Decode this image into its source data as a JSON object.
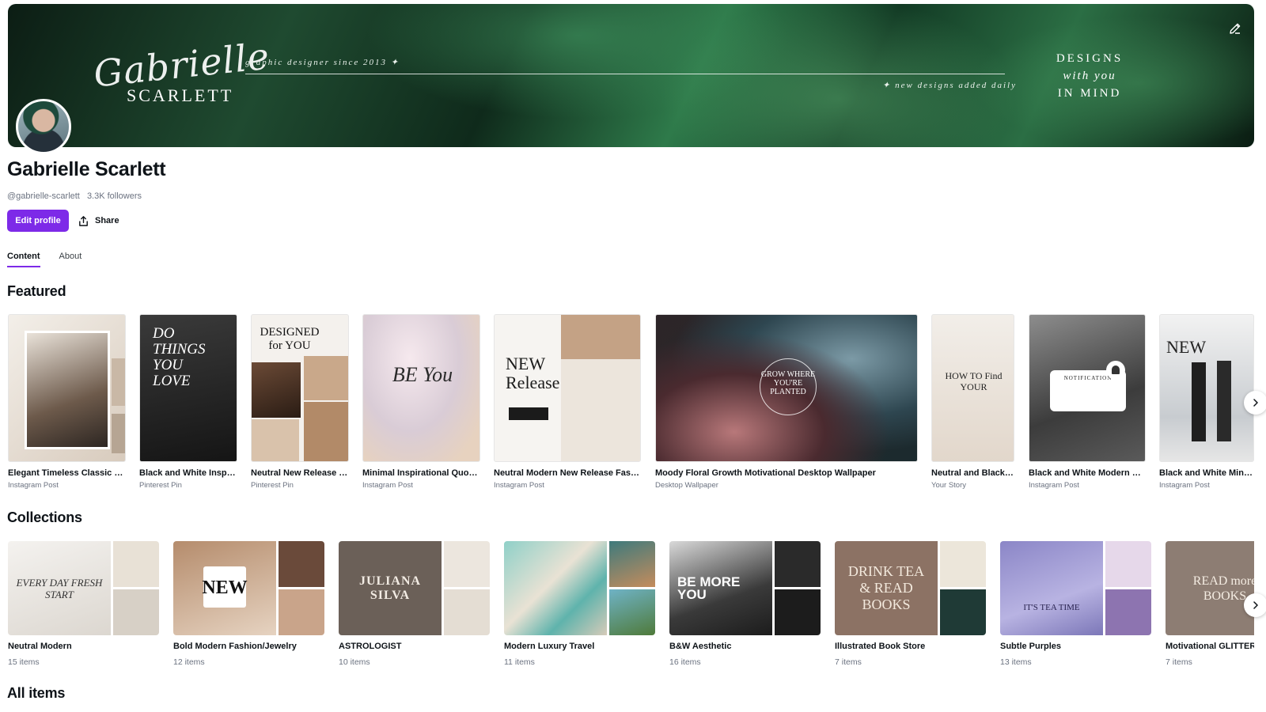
{
  "banner": {
    "script_name": "Gabrielle",
    "surname": "SCARLETT",
    "tagline_left": "graphic designer since 2013 ✦",
    "tagline_right": "✦ new designs added daily",
    "motto_1": "DESIGNS",
    "motto_2": "with you",
    "motto_3": "IN MIND"
  },
  "profile": {
    "name": "Gabrielle Scarlett",
    "handle": "@gabrielle-scarlett",
    "followers": "3.3K followers",
    "edit_label": "Edit profile",
    "share_label": "Share"
  },
  "tabs": [
    {
      "label": "Content",
      "active": true
    },
    {
      "label": "About",
      "active": false
    }
  ],
  "featured": {
    "title": "Featured",
    "items": [
      {
        "title": "Elegant Timeless Classic Sea...",
        "type": "Instagram Post"
      },
      {
        "title": "Black and White Inspira...",
        "type": "Pinterest Pin",
        "thumb_text": "DO THINGS YOU LOVE"
      },
      {
        "title": "Neutral New Release Fa...",
        "type": "Pinterest Pin",
        "thumb_text": "DESIGNED for YOU"
      },
      {
        "title": "Minimal Inspirational Quote ...",
        "type": "Instagram Post",
        "thumb_text": "BE You"
      },
      {
        "title": "Neutral Modern New Release Fashio...",
        "type": "Instagram Post",
        "thumb_text": "NEW Release"
      },
      {
        "title": "Moody Floral Growth Motivational Desktop Wallpaper",
        "type": "Desktop Wallpaper",
        "thumb_text": "GROW WHERE YOU'RE PLANTED"
      },
      {
        "title": "Neutral and Black ...",
        "type": "Your Story",
        "thumb_text": "HOW TO Find YOUR"
      },
      {
        "title": "Black and White Modern Mi...",
        "type": "Instagram Post",
        "thumb_text": "NOTIFICATION"
      },
      {
        "title": "Black and White Minimal",
        "type": "Instagram Post",
        "thumb_text": "NEW"
      }
    ]
  },
  "collections": {
    "title": "Collections",
    "items": [
      {
        "title": "Neutral Modern",
        "count": "15 items",
        "thumb_text": "EVERY DAY FRESH START"
      },
      {
        "title": "Bold Modern Fashion/Jewelry",
        "count": "12 items",
        "thumb_text": "NEW"
      },
      {
        "title": "ASTROLOGIST",
        "count": "10 items",
        "thumb_text": "JULIANA SILVA"
      },
      {
        "title": "Modern Luxury Travel",
        "count": "11 items"
      },
      {
        "title": "B&W Aesthetic",
        "count": "16 items",
        "thumb_text": "BE MORE YOU"
      },
      {
        "title": "Illustrated Book Store",
        "count": "7 items",
        "thumb_text": "DRINK TEA & READ BOOKS"
      },
      {
        "title": "Subtle Purples",
        "count": "13 items",
        "thumb_text": "IT'S TEA TIME"
      },
      {
        "title": "Motivational GLITTER",
        "count": "7 items",
        "thumb_text": "READ more BOOKS"
      }
    ]
  },
  "all_items": {
    "title": "All items"
  },
  "colors": {
    "accent": "#7d2ae8",
    "banner_green": "#1f4a30"
  }
}
